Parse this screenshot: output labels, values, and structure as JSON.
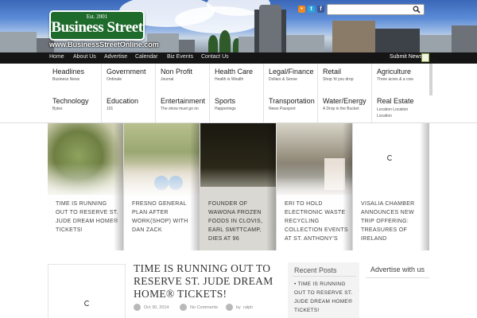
{
  "brand": {
    "est": "Est. 2001",
    "name": "Business Street",
    "url": "www.BusinessStreetOnline.com"
  },
  "colors": {
    "brand_green": "#1f6b2c",
    "nav_bg": "#151515",
    "rss": "#f18a1c",
    "twitter": "#2aa3dc",
    "facebook": "#3b5998"
  },
  "header": {
    "social_icons": [
      "rss-icon",
      "twitter-icon",
      "facebook-icon"
    ],
    "search": {
      "placeholder": "",
      "icon": "search-icon"
    }
  },
  "topnav": {
    "items": [
      "Home",
      "About Us",
      "Advertise",
      "Calendar",
      "Biz Events",
      "Contact Us"
    ],
    "submit_news": "Submit News"
  },
  "menu": {
    "rows": [
      [
        {
          "title": "Headlines",
          "sub": "Business News"
        },
        {
          "title": "Government",
          "sub": "Ordinate"
        },
        {
          "title": "Non Profit",
          "sub": "Journal"
        },
        {
          "title": "Health Care",
          "sub": "Health is Wealth"
        },
        {
          "title": "Legal/Finance",
          "sub": "Dollars & Sense"
        },
        {
          "title": "Retail",
          "sub": "Shop 'til you drop"
        },
        {
          "title": "Agriculture",
          "sub": "Three acres & a cow"
        }
      ],
      [
        {
          "title": "Technology",
          "sub": "Bytes"
        },
        {
          "title": "Education",
          "sub": "101"
        },
        {
          "title": "Entertainment",
          "sub": "The show must go on"
        },
        {
          "title": "Sports",
          "sub": "Happenings"
        },
        {
          "title": "Transportation",
          "sub": "News Passport"
        },
        {
          "title": "Water/Energy",
          "sub": "A Drop in the Bucket"
        },
        {
          "title": "Real Estate",
          "sub": "Location Location Location"
        }
      ]
    ]
  },
  "slider": [
    {
      "caption": "TIME IS RUNNING OUT TO RESERVE ST. JUDE DREAM HOME® TICKETS!"
    },
    {
      "caption": "FRESNO GENERAL PLAN AFTER WORK(SHOP) WITH DAN ZACK"
    },
    {
      "caption": "FOUNDER OF WAWONA FROZEN FOODS IN CLOVIS, EARL SMITTCAMP, DIES AT 96"
    },
    {
      "caption": "ERI TO HOLD ELECTRONIC WASTE RECYCLING COLLECTION EVENTS AT ST. ANTHONY'S"
    },
    {
      "caption": "VISALIA CHAMBER ANNOUNCES NEW TRIP OFFERING: TREASURES OF IRELAND"
    }
  ],
  "post": {
    "title": "TIME IS RUNNING OUT TO RESERVE ST. JUDE DREAM HOME® TICKETS!",
    "date": "Oct 30, 2014",
    "comments": "No Comments",
    "author_prefix": "by",
    "author": "ralph"
  },
  "sidebar": {
    "recent_posts_heading": "Recent Posts",
    "recent_posts": [
      "TIME IS RUNNING OUT TO RESERVE ST. JUDE DREAM HOME® TICKETS!"
    ],
    "advertise_heading": "Advertise with us"
  }
}
